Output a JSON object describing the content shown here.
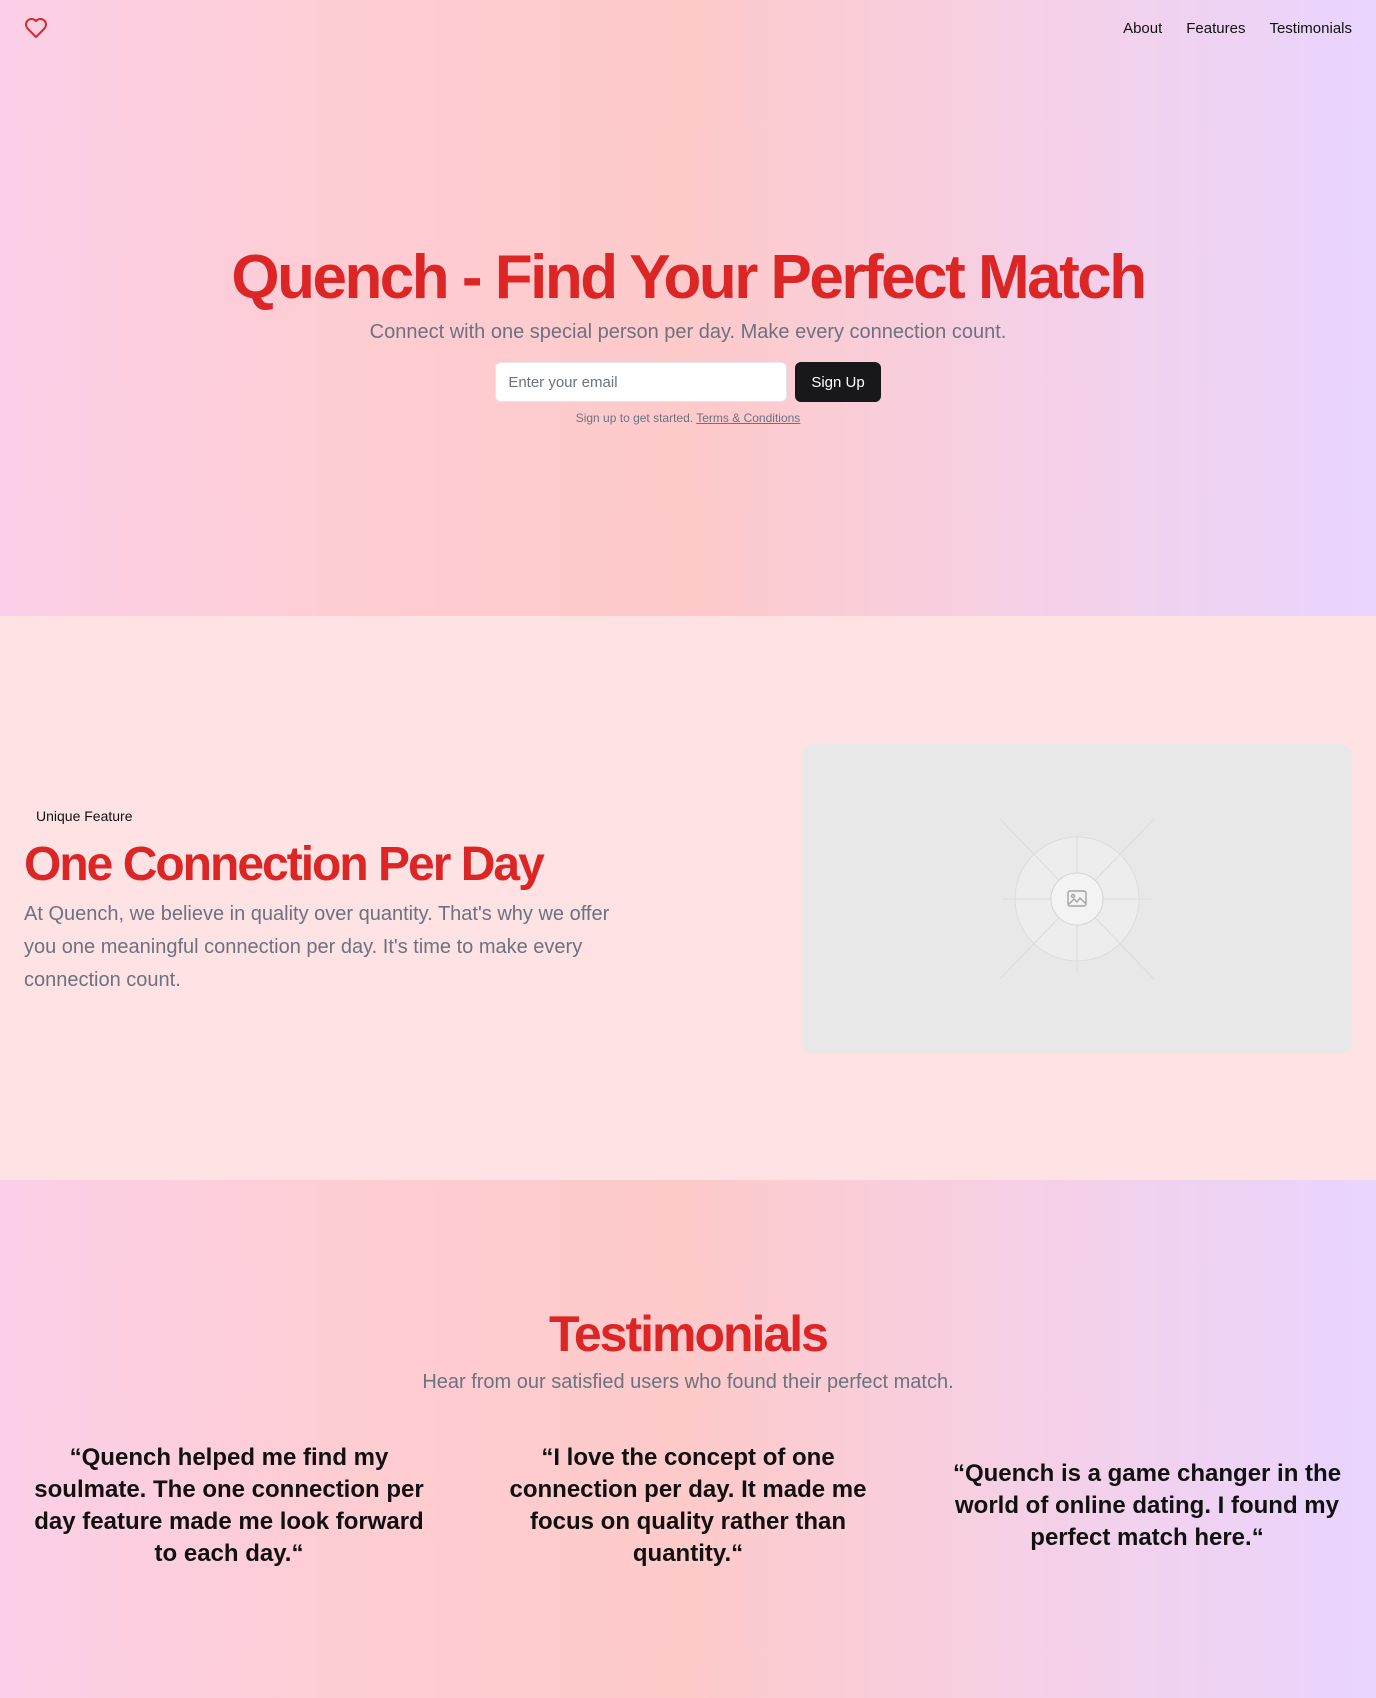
{
  "colors": {
    "accent": "#dc2626",
    "muted": "#6b7280",
    "button_bg": "#18181b"
  },
  "header": {
    "logo_icon": "heart-icon",
    "nav": [
      {
        "label": "About"
      },
      {
        "label": "Features"
      },
      {
        "label": "Testimonials"
      }
    ]
  },
  "hero": {
    "title": "Quench - Find Your Perfect Match",
    "subtitle": "Connect with one special person per day. Make every connection count.",
    "email_placeholder": "Enter your email",
    "signup_label": "Sign Up",
    "fine_print": "Sign up to get started.",
    "terms_label": "Terms & Conditions"
  },
  "feature": {
    "badge": "Unique Feature",
    "title": "One Connection Per Day",
    "text": "At Quench, we believe in quality over quantity. That's why we offer you one meaningful connection per day. It's time to make every connection count.",
    "image_icon": "image-placeholder-icon"
  },
  "testimonials": {
    "title": "Testimonials",
    "subtitle": "Hear from our satisfied users who found their perfect match.",
    "quotes": [
      {
        "text": "“Quench helped me find my soulmate. The one connection per day feature made me look forward to each day.“"
      },
      {
        "text": "“I love the concept of one connection per day. It made me focus on quality rather than quantity.“"
      },
      {
        "text": "“Quench is a game changer in the world of online dating. I found my perfect match here.“"
      }
    ]
  }
}
